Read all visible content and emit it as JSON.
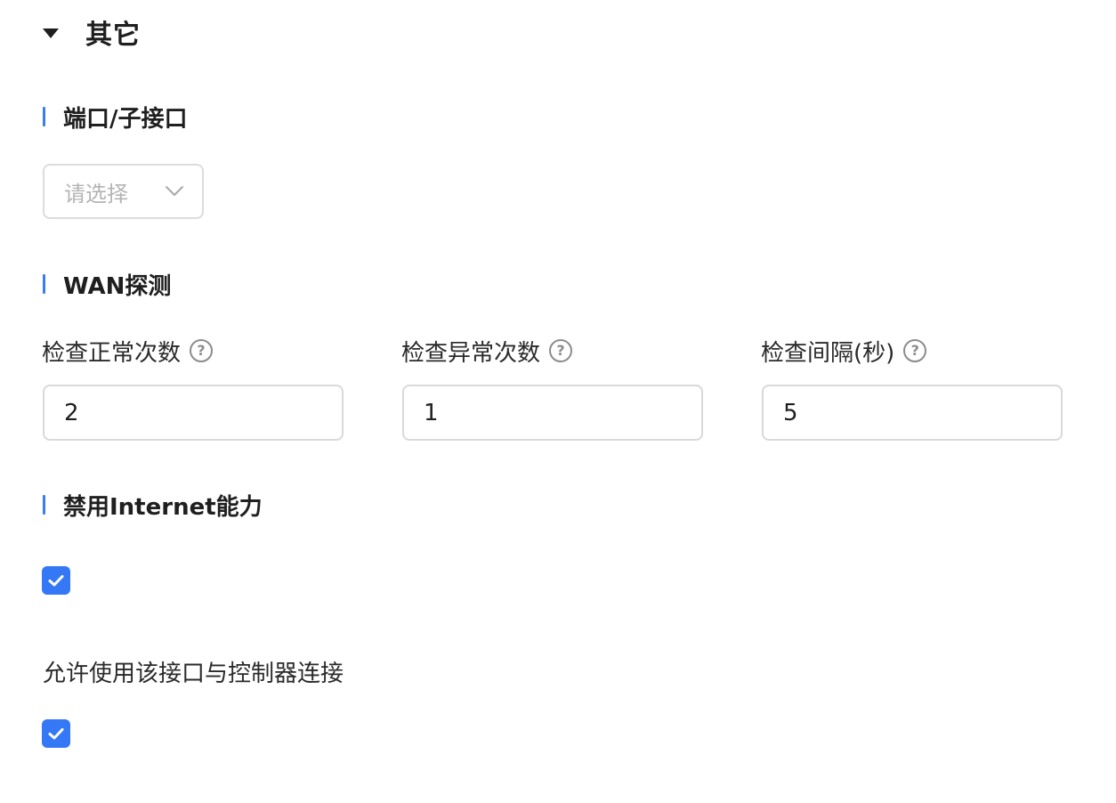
{
  "section": {
    "title": "其它",
    "expanded": true
  },
  "port": {
    "header": "端口/子接口",
    "select_placeholder": "请选择"
  },
  "wan_probe": {
    "header": "WAN探测",
    "fields": [
      {
        "label": "检查正常次数",
        "value": "2"
      },
      {
        "label": "检查异常次数",
        "value": "1"
      },
      {
        "label": "检查间隔(秒)",
        "value": "5"
      }
    ],
    "help_glyph": "?"
  },
  "disable_internet": {
    "header": "禁用Internet能力",
    "checked": true
  },
  "allow_controller": {
    "label": "允许使用该接口与控制器连接",
    "checked": true
  },
  "colors": {
    "accent": "#3478f6",
    "group_bar": "#3b7cf0",
    "border": "#d9d9d9",
    "placeholder": "#b4b4b4"
  }
}
